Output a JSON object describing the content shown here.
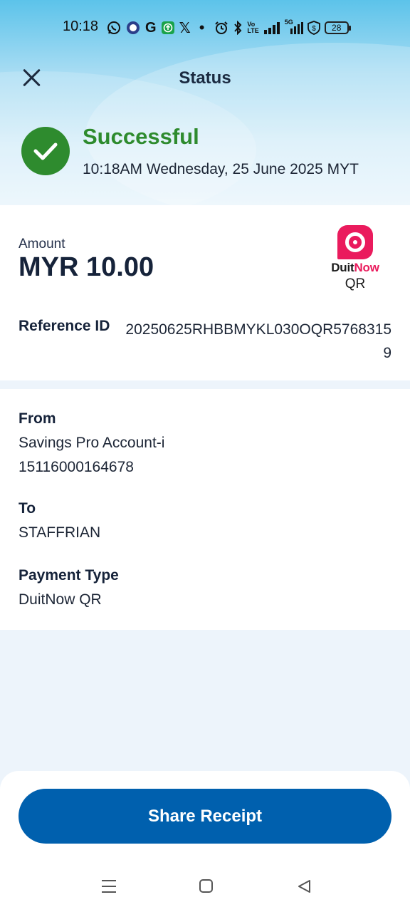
{
  "status_bar": {
    "time": "10:18",
    "network_label": "5G",
    "battery": "28",
    "icons": [
      "whatsapp-icon",
      "lion-app-icon",
      "g-icon",
      "upload-icon",
      "x-icon",
      "dot-icon",
      "alarm-icon",
      "bluetooth-icon",
      "volte-icon",
      "signal-icon",
      "5g-signal-icon",
      "vpn-shield-icon",
      "battery-icon"
    ]
  },
  "header": {
    "title": "Status"
  },
  "result": {
    "title": "Successful",
    "timestamp": "10:18AM Wednesday, 25 June 2025 MYT"
  },
  "transaction": {
    "amount_label": "Amount",
    "amount_value": "MYR 10.00",
    "brand_duit": "Duit",
    "brand_now": "Now",
    "brand_qr": "QR",
    "reference_label": "Reference ID",
    "reference_value": "20250625RHBBMYKL030OQR57683159"
  },
  "details": {
    "from_label": "From",
    "from_account_name": "Savings Pro Account-i",
    "from_account_number": "15116000164678",
    "to_label": "To",
    "to_value": "STAFFRIAN",
    "payment_type_label": "Payment Type",
    "payment_type_value": "DuitNow QR"
  },
  "actions": {
    "share_label": "Share Receipt"
  },
  "colors": {
    "success": "#2e8b2e",
    "primary_button": "#0060ae",
    "duitnow_brand": "#ea1b5d"
  }
}
